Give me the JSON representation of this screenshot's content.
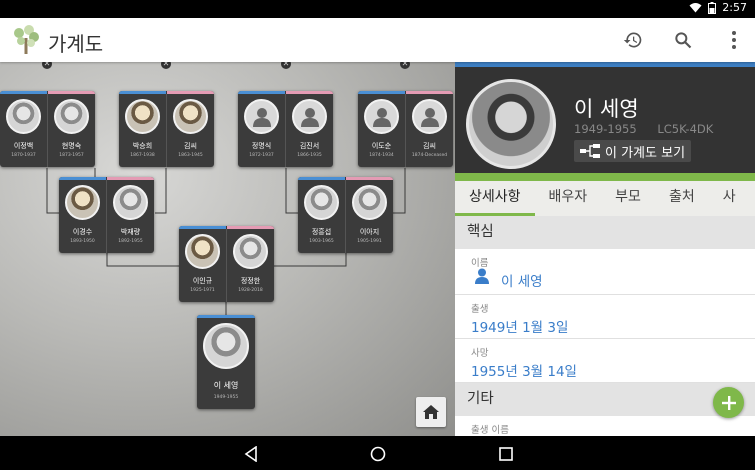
{
  "status_bar": {
    "time": "2:57",
    "icons": [
      "wifi-icon",
      "battery-icon"
    ]
  },
  "app_bar": {
    "title": "가계도",
    "actions": [
      "history-icon",
      "search-icon",
      "overflow-menu-icon"
    ]
  },
  "tree": {
    "great_grandparents": [
      {
        "husband": {
          "name": "이정백",
          "dates": "1870-1937"
        },
        "wife": {
          "name": "현명숙",
          "dates": "1873-1957"
        }
      },
      {
        "husband": {
          "name": "박승희",
          "dates": "1867-1938"
        },
        "wife": {
          "name": "김씨",
          "dates": "1863-1945"
        }
      },
      {
        "husband": {
          "name": "정명식",
          "dates": "1872-1937"
        },
        "wife": {
          "name": "김진서",
          "dates": "1866-1935"
        }
      },
      {
        "husband": {
          "name": "이도순",
          "dates": "1874-1934"
        },
        "wife": {
          "name": "김씨",
          "dates": "1874-Deceased"
        }
      }
    ],
    "grandparents": [
      {
        "husband": {
          "name": "이경수",
          "dates": "1893-1950"
        },
        "wife": {
          "name": "박재량",
          "dates": "1892-1955"
        }
      },
      {
        "husband": {
          "name": "정흥섭",
          "dates": "1903-1965"
        },
        "wife": {
          "name": "이아지",
          "dates": "1905-1991"
        }
      }
    ],
    "parents": {
      "husband": {
        "name": "이인규",
        "dates": "1925-1971"
      },
      "wife": {
        "name": "정정한",
        "dates": "1928-2018"
      }
    },
    "focus": {
      "name": "이 세영",
      "dates": "1949-1955"
    }
  },
  "detail": {
    "name": "이 세영",
    "lifespan": "1949-1955",
    "pid": "LC5K-4DK",
    "view_tree_label": "이 가계도 보기",
    "tabs": [
      "상세사항",
      "배우자",
      "부모",
      "출처",
      "사"
    ],
    "active_tab": "상세사항",
    "sections": {
      "core": {
        "title": "핵심",
        "name_label": "이름",
        "name_value": "이 세영",
        "birth_label": "출생",
        "birth_value": "1949년 1월 3일",
        "death_label": "사망",
        "death_value": "1955년 3월 14일"
      },
      "other": {
        "title": "기타",
        "birth_name_label": "출생 이름"
      }
    }
  },
  "nav_bar": [
    "back-icon",
    "home-icon",
    "recents-icon"
  ],
  "colors": {
    "male": "#4a8fd4",
    "female": "#e49bb4",
    "accent_green": "#7fb84a",
    "link_blue": "#3a7dc9"
  }
}
